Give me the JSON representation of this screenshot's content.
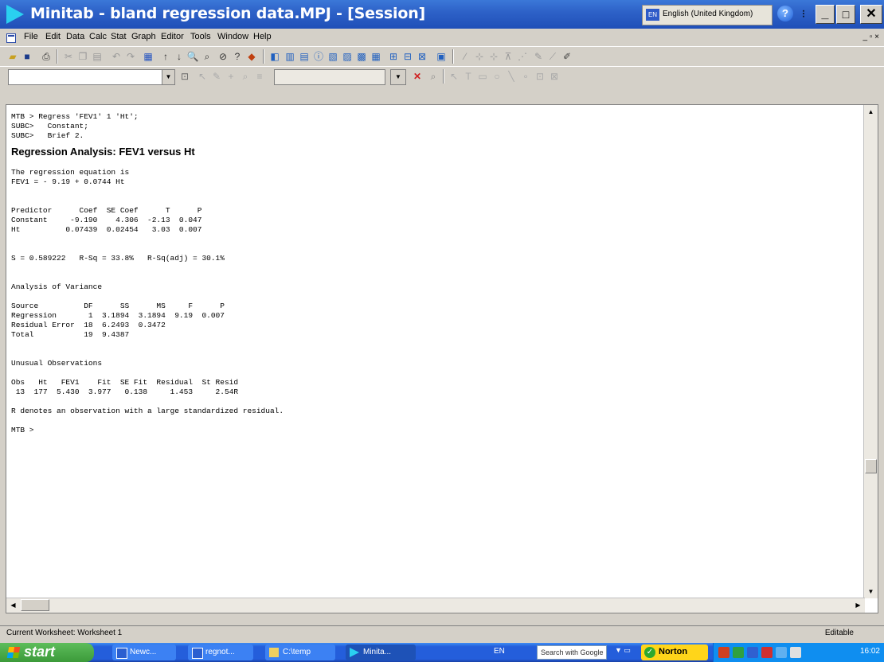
{
  "window": {
    "title": "Minitab - bland regression data.MPJ - [Session]"
  },
  "language_bar": {
    "badge": "EN",
    "language": "English (United Kingdom)"
  },
  "title_buttons": {
    "minimize": "_",
    "maximize": "□",
    "close": "✕"
  },
  "menubar": {
    "items": [
      "File",
      "Edit",
      "Data",
      "Calc",
      "Stat",
      "Graph",
      "Editor",
      "Tools",
      "Window",
      "Help"
    ],
    "mdi_controls": "_ ▫ ×"
  },
  "session": {
    "lines_before_heading": [
      "MTB > Regress 'FEV1' 1 'Ht';",
      "SUBC>   Constant;",
      "SUBC>   Brief 2."
    ],
    "heading": "Regression Analysis: FEV1 versus Ht",
    "lines_after_heading": [
      "The regression equation is",
      "FEV1 = - 9.19 + 0.0744 Ht",
      "",
      "",
      "Predictor      Coef  SE Coef      T      P",
      "Constant     -9.190    4.306  -2.13  0.047",
      "Ht          0.07439  0.02454   3.03  0.007",
      "",
      "",
      "S = 0.589222   R-Sq = 33.8%   R-Sq(adj) = 30.1%",
      "",
      "",
      "Analysis of Variance",
      "",
      "Source          DF      SS      MS     F      P",
      "Regression       1  3.1894  3.1894  9.19  0.007",
      "Residual Error  18  6.2493  0.3472",
      "Total           19  9.4387",
      "",
      "",
      "Unusual Observations",
      "",
      "Obs   Ht   FEV1    Fit  SE Fit  Residual  St Resid",
      " 13  177  5.430  3.977   0.138     1.453     2.54R",
      "",
      "R denotes an observation with a large standardized residual.",
      "",
      "MTB >"
    ]
  },
  "statusbar": {
    "left": "Current Worksheet: Worksheet 1",
    "right": "Editable"
  },
  "taskbar": {
    "start": "start",
    "tasks": [
      "Newc...",
      "regnot...",
      "C:\\temp",
      "Minita..."
    ],
    "lang": "EN",
    "search_placeholder": "Search with Google",
    "norton": "Norton",
    "clock": "16:02"
  }
}
